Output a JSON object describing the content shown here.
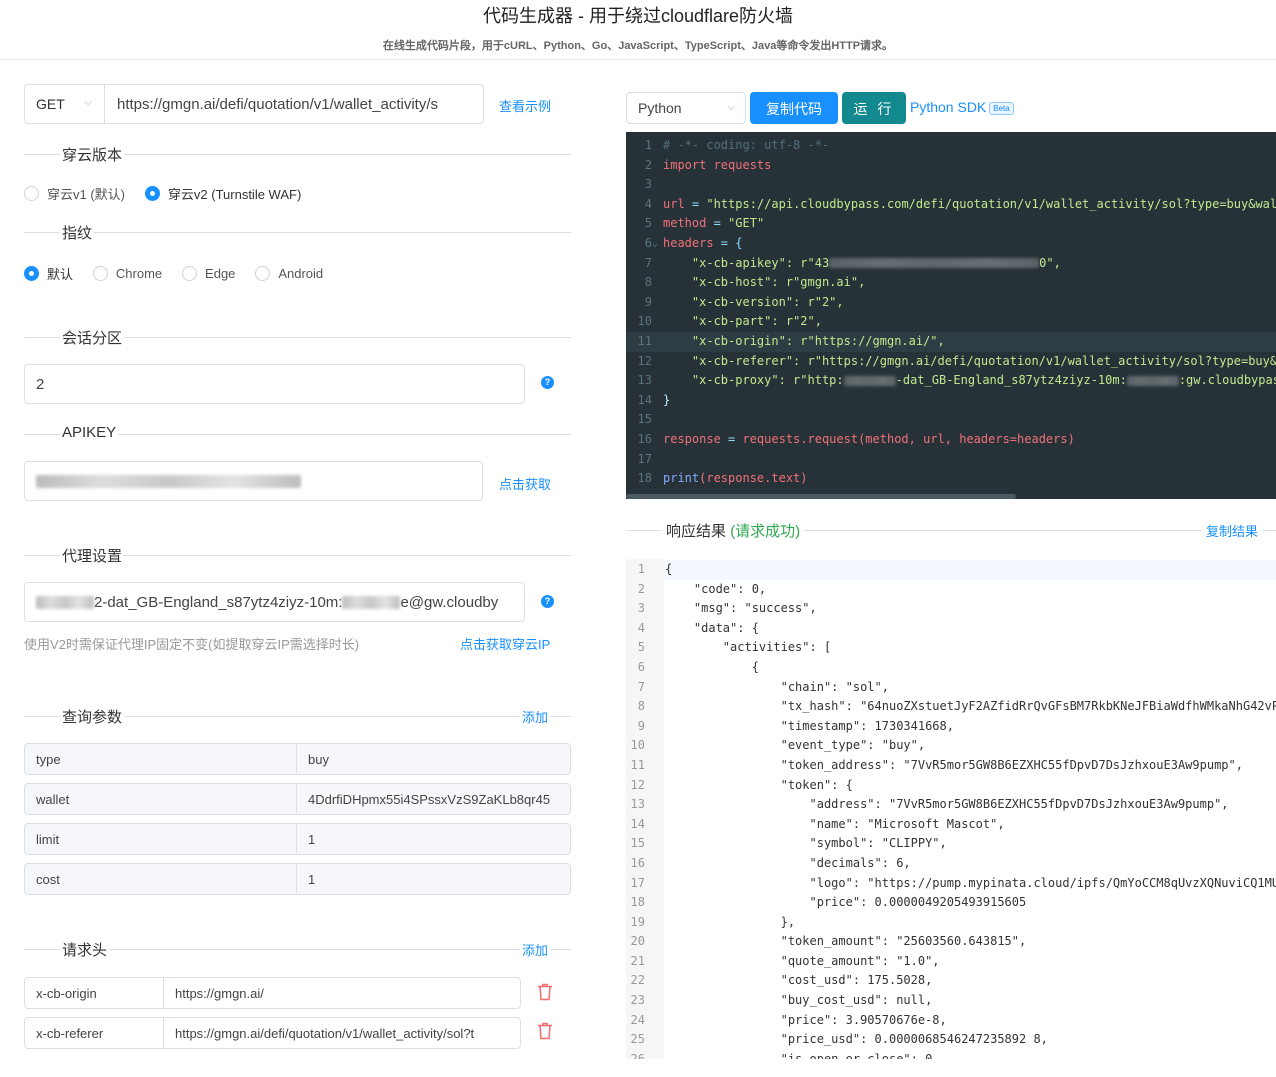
{
  "header": {
    "title": "代码生成器 - 用于绕过cloudflare防火墙",
    "subtitle": "在线生成代码片段，用于cURL、Python、Go、JavaScript、TypeScript、Java等命令发出HTTP请求。"
  },
  "request": {
    "method": "GET",
    "url": "https://gmgn.ai/defi/quotation/v1/wallet_activity/s",
    "example_link": "查看示例"
  },
  "version_section": {
    "title": "穿云版本",
    "options": [
      "穿云v1 (默认)",
      "穿云v2 (Turnstile WAF)"
    ],
    "selected": 1
  },
  "fingerprint_section": {
    "title": "指纹",
    "options": [
      "默认",
      "Chrome",
      "Edge",
      "Android"
    ],
    "selected": 0
  },
  "session_section": {
    "title": "会话分区",
    "value": "2"
  },
  "apikey_section": {
    "title": "APIKEY",
    "get_link": "点击获取"
  },
  "proxy_section": {
    "title": "代理设置",
    "value_middle": "2-dat_GB-England_s87ytz4ziyz-10m:",
    "value_tail": "e@gw.cloudby",
    "hint": "使用V2时需保证代理IP固定不变(如提取穿云IP需选择时长)",
    "get_ip_link": "点击获取穿云IP"
  },
  "query_section": {
    "title": "查询参数",
    "add": "添加",
    "params": [
      {
        "key": "type",
        "value": "buy"
      },
      {
        "key": "wallet",
        "value": "4DdrfiDHpmx55i4SPssxVzS9ZaKLb8qr45"
      },
      {
        "key": "limit",
        "value": "1"
      },
      {
        "key": "cost",
        "value": "1"
      }
    ]
  },
  "headers_section": {
    "title": "请求头",
    "add": "添加",
    "headers": [
      {
        "key": "x-cb-origin",
        "value": "https://gmgn.ai/"
      },
      {
        "key": "x-cb-referer",
        "value": "https://gmgn.ai/defi/quotation/v1/wallet_activity/sol?t"
      }
    ]
  },
  "toolbar": {
    "language": "Python",
    "copy_code": "复制代码",
    "run": "运 行",
    "sdk": "Python SDK",
    "beta": "Beta"
  },
  "code_lines": [
    "1",
    "2",
    "3",
    "4",
    "5",
    "6",
    "7",
    "8",
    "9",
    "10",
    "11",
    "12",
    "13",
    "14",
    "15",
    "16",
    "17",
    "18"
  ],
  "code": {
    "l1": "# -*- coding: utf-8 -*-",
    "l2_kw": "import",
    "l2_mod": " requests",
    "l4_var": "url",
    "l4_eq": " = ",
    "l4_str": "\"https://api.cloudbypass.com/defi/quotation/v1/wallet_activity/sol?type=buy&walle",
    "l5_var": "method",
    "l5_eq": " = ",
    "l5_str": "\"GET\"",
    "l6_var": "headers",
    "l6_eq": " = {",
    "l7_a": "    \"x-cb-apikey\": r\"43",
    "l7_b": "0\",",
    "l8": "    \"x-cb-host\": r\"gmgn.ai\",",
    "l9": "    \"x-cb-version\": r\"2\",",
    "l10": "    \"x-cb-part\": r\"2\",",
    "l11": "    \"x-cb-origin\": r\"https://gmgn.ai/\",",
    "l12": "    \"x-cb-referer\": r\"https://gmgn.ai/defi/quotation/v1/wallet_activity/sol?type=buy&wal",
    "l13_a": "    \"x-cb-proxy\": r\"http:",
    "l13_b": "-dat_GB-England_s87ytz4ziyz-10m:",
    "l13_c": ":gw.cloudbypas",
    "l14": "}",
    "l16_var": "response",
    "l16_eq": " = ",
    "l16_fn": "requests.request",
    "l16_args": "(method, url, headers=headers)",
    "l18_fn": "print",
    "l18_args": "(response.text)"
  },
  "result_section": {
    "title": "响应结果",
    "status": "(请求成功)",
    "copy": "复制结果"
  },
  "result_lines": [
    "{",
    "    \"code\": 0,",
    "    \"msg\": \"success\",",
    "    \"data\": {",
    "        \"activities\": [",
    "            {",
    "                \"chain\": \"sol\",",
    "                \"tx_hash\": \"64nuoZXstuetJyF2AZfidRrQvGFsBM7RkbKNeJFBiaWdfhWMkaNhG42vPBbv",
    "                \"timestamp\": 1730341668,",
    "                \"event_type\": \"buy\",",
    "                \"token_address\": \"7VvR5mor5GW8B6EZXHC55fDpvD7DsJzhxouE3Aw9pump\",",
    "                \"token\": {",
    "                    \"address\": \"7VvR5mor5GW8B6EZXHC55fDpvD7DsJzhxouE3Aw9pump\",",
    "                    \"name\": \"Microsoft Mascot\",",
    "                    \"symbol\": \"CLIPPY\",",
    "                    \"decimals\": 6,",
    "                    \"logo\": \"https://pump.mypinata.cloud/ipfs/QmYoCCM8qUvzXQNuviCQ1MUXR",
    "                    \"price\": 0.0000049205493915605",
    "                },",
    "                \"token_amount\": \"25603560.643815\",",
    "                \"quote_amount\": \"1.0\",",
    "                \"cost_usd\": 175.5028,",
    "                \"buy_cost_usd\": null,",
    "                \"price\": 3.90570676e-8,",
    "                \"price_usd\": 0.0000068546247235892 8,",
    "                \"is_open_or_close\": 0,"
  ],
  "colors": {
    "accent": "#1890ff",
    "run": "#12888f",
    "success": "#2fa84f",
    "code_bg": "#263238"
  }
}
